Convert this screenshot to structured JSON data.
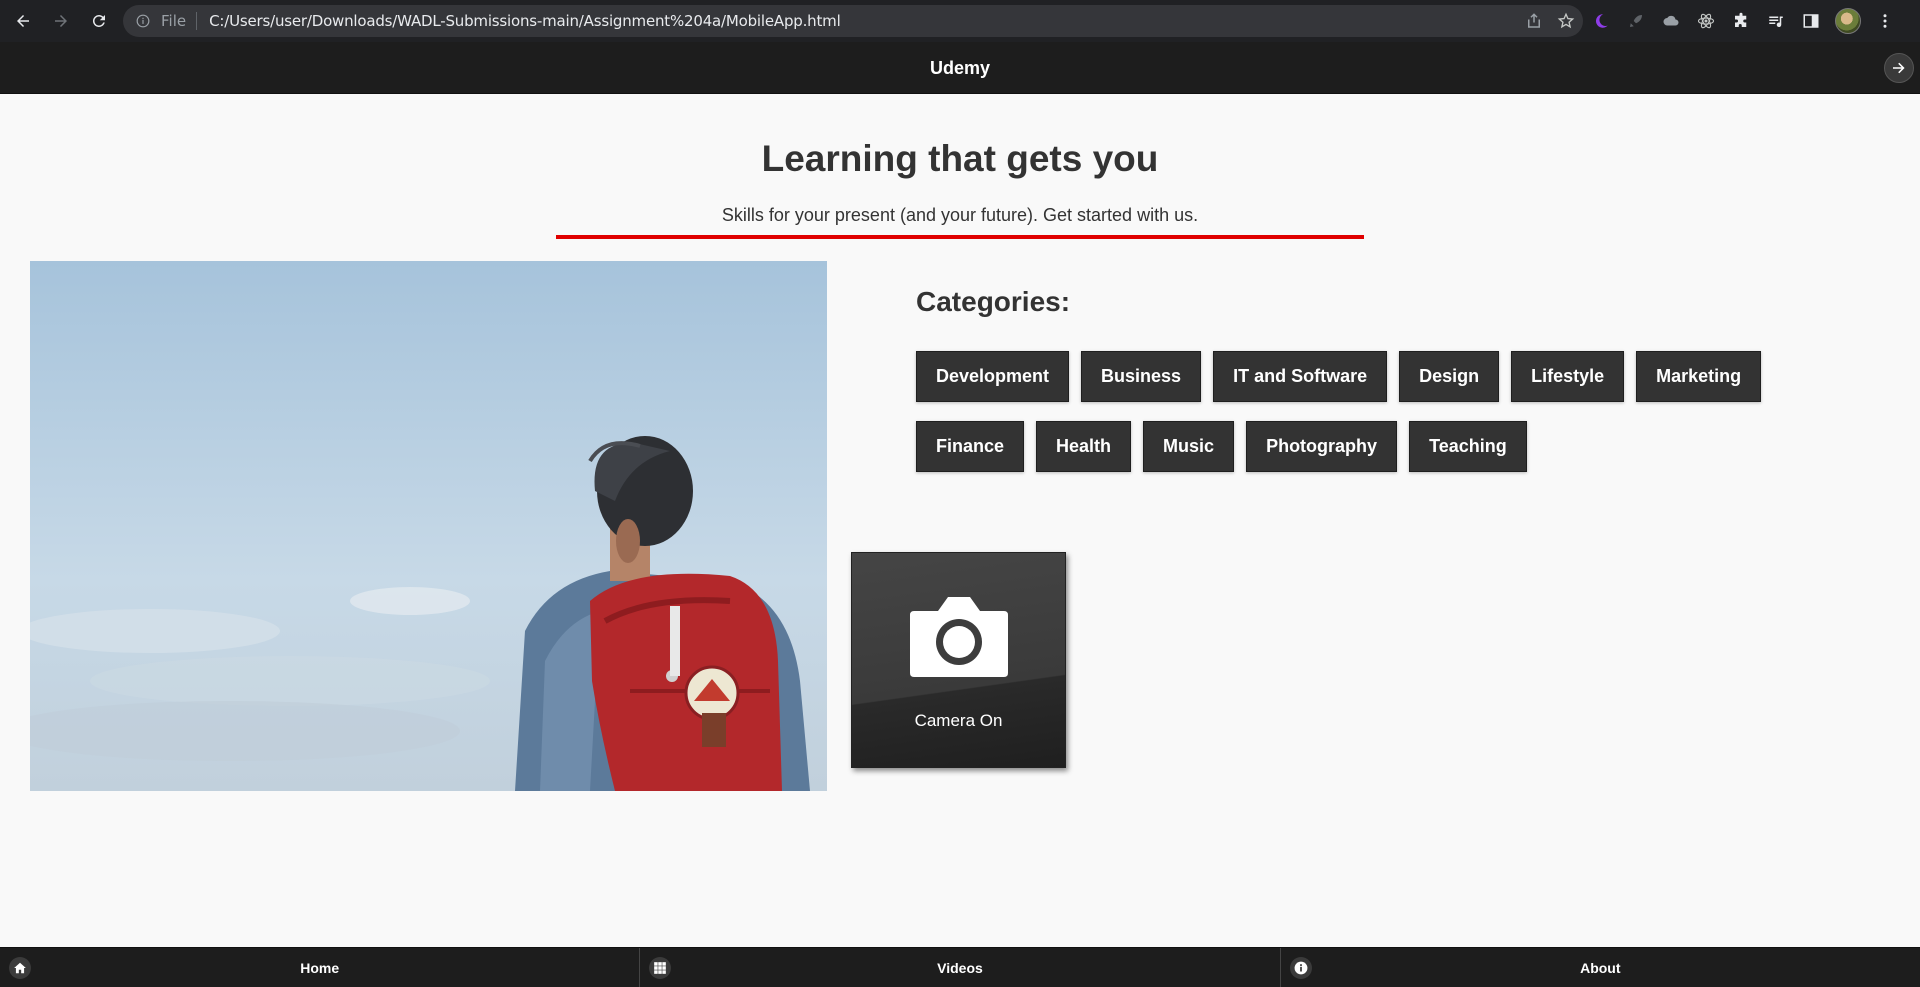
{
  "browser": {
    "scheme_label": "File",
    "url": "C:/Users/user/Downloads/WADL-Submissions-main/Assignment%204a/MobileApp.html"
  },
  "header": {
    "title": "Udemy",
    "action_icon": "arrow-right-icon"
  },
  "hero": {
    "headline": "Learning that gets you",
    "tagline": "Skills for your present (and your future). Get started with us.",
    "rule_color": "#e00000"
  },
  "categories": {
    "title": "Categories:",
    "row1": [
      "Development",
      "Business",
      "IT and Software",
      "Design",
      "Lifestyle",
      "Marketing"
    ],
    "row2": [
      "Finance",
      "Health",
      "Music",
      "Photography",
      "Teaching"
    ]
  },
  "camera": {
    "label": "Camera On",
    "icon": "camera-icon"
  },
  "footer": {
    "items": [
      {
        "label": "Home",
        "icon": "home-icon"
      },
      {
        "label": "Videos",
        "icon": "grid-icon"
      },
      {
        "label": "About",
        "icon": "info-icon"
      }
    ]
  },
  "colors": {
    "header_bg": "#1d1d1d",
    "button_bg": "#333333",
    "page_bg": "#f9f9f9",
    "accent_red": "#e00000"
  }
}
